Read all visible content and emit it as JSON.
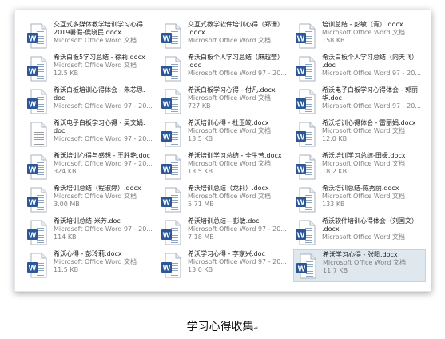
{
  "caption": {
    "text": "学习心得收集",
    "mark": "↵"
  },
  "colors": {
    "word_blue": "#2b5797",
    "doc_gray": "#9a9a9a",
    "selection": "#dfe7ef"
  },
  "files": [
    {
      "lines": [
        "交互式多媒体教学培训学习心得",
        "2019暑假-侯晓民.docx"
      ],
      "meta": [
        "Microsoft Office Word 文档"
      ],
      "icon": "word-doc-icon"
    },
    {
      "lines": [
        "交互式教学软件培训心得（郑珊）",
        ".docx"
      ],
      "meta": [
        "Microsoft Office Word 文档"
      ],
      "icon": "word-doc-icon"
    },
    {
      "lines": [
        "培训总结 - 彭敏（青）.docx"
      ],
      "meta": [
        "Microsoft Office Word 文档",
        "158 KB"
      ],
      "icon": "word-doc-icon"
    },
    {
      "lines": [
        "希沃白板5学习总结 - 徐莉.docx"
      ],
      "meta": [
        "Microsoft Office Word 文档",
        "12.5 KB"
      ],
      "icon": "word-doc-icon"
    },
    {
      "lines": [
        "希沃白板个人学习总结（麻超莹）",
        ".doc"
      ],
      "meta": [
        "Microsoft Office Word 97 - 20..."
      ],
      "icon": "word-doc-icon"
    },
    {
      "lines": [
        "希沃白板个人学习总结（向天飞）",
        ".doc"
      ],
      "meta": [
        "Microsoft Office Word 97 - 20..."
      ],
      "icon": "word-doc-icon"
    },
    {
      "lines": [
        "希沃白板培训心得体会 - 朱芯思.",
        "doc"
      ],
      "meta": [
        "Microsoft Office Word 97 - 20..."
      ],
      "icon": "word-doc-icon"
    },
    {
      "lines": [
        "希沃白板学习心得 - 付凡.docx"
      ],
      "meta": [
        "Microsoft Office Word 文档",
        "727 KB"
      ],
      "icon": "word-doc-icon"
    },
    {
      "lines": [
        "希沃电子白板学习心得体会 - 郭丽",
        "华.doc"
      ],
      "meta": [
        "Microsoft Office Word 97 - 20..."
      ],
      "icon": "word-doc-icon"
    },
    {
      "lines": [
        "希沃电子白板学习心得 - 吴文娟.",
        "doc"
      ],
      "meta": [
        "Microsoft Office Word 97 - 20..."
      ],
      "icon": "doc-generic-icon"
    },
    {
      "lines": [
        "希沃培训心得 - 杜玉皎.docx"
      ],
      "meta": [
        "Microsoft Office Word 文档",
        "13.5 KB"
      ],
      "icon": "word-doc-icon"
    },
    {
      "lines": [
        "希沃培训心得体会 - 雷丽娟.docx"
      ],
      "meta": [
        "Microsoft Office Word 文档",
        "12.0 KB"
      ],
      "icon": "word-doc-icon"
    },
    {
      "lines": [
        "希沃培训心得与感想 - 王胜艳.doc"
      ],
      "meta": [
        "Microsoft Office Word 97 - 20...",
        "324 KB"
      ],
      "icon": "word-doc-icon"
    },
    {
      "lines": [
        "希沃培训学习总结 - 全生芳.docx"
      ],
      "meta": [
        "Microsoft Office Word 文档",
        "13.5 KB"
      ],
      "icon": "word-doc-icon"
    },
    {
      "lines": [
        "希沃培训学习总结-田媛.docx"
      ],
      "meta": [
        "Microsoft Office Word 文档",
        "18.2 KB"
      ],
      "icon": "word-doc-icon"
    },
    {
      "lines": [
        "希沃培训总结（程淑婷）.docx"
      ],
      "meta": [
        "Microsoft Office Word 文档",
        "3.00 MB"
      ],
      "icon": "word-doc-icon"
    },
    {
      "lines": [
        "希沃培训总结（龙莉）.docx"
      ],
      "meta": [
        "Microsoft Office Word 文档",
        "5.71 MB"
      ],
      "icon": "word-doc-icon"
    },
    {
      "lines": [
        "希沃培训总结-陈秀丽.docx"
      ],
      "meta": [
        "Microsoft Office Word 文档",
        "133 KB"
      ],
      "icon": "word-doc-icon"
    },
    {
      "lines": [
        "希沃培训总结-米芳.doc"
      ],
      "meta": [
        "Microsoft Office Word 97 - 20...",
        "114 KB"
      ],
      "icon": "word-doc-icon"
    },
    {
      "lines": [
        "希沃培训总结---彭敏.doc"
      ],
      "meta": [
        "Microsoft Office Word 97 - 20...",
        "7.18 MB"
      ],
      "icon": "word-doc-icon"
    },
    {
      "lines": [
        "希沃软件培训心得体会（刘国文）",
        ".docx"
      ],
      "meta": [
        "Microsoft Office Word 文档"
      ],
      "icon": "word-doc-icon"
    },
    {
      "lines": [
        "希沃心得 - 彭玲莉.docx"
      ],
      "meta": [
        "Microsoft Office Word 文档",
        "11.5 KB"
      ],
      "icon": "word-doc-icon"
    },
    {
      "lines": [
        "希沃学习心得 - 李家兴.doc"
      ],
      "meta": [
        "Microsoft Office Word 97 - 20...",
        "13.0 KB"
      ],
      "icon": "word-doc-icon"
    },
    {
      "lines": [
        "希沃学习心得 - 张阳.docx"
      ],
      "meta": [
        "Microsoft Office Word 文档",
        "11.7 KB"
      ],
      "icon": "word-doc-icon",
      "selected": true
    }
  ]
}
